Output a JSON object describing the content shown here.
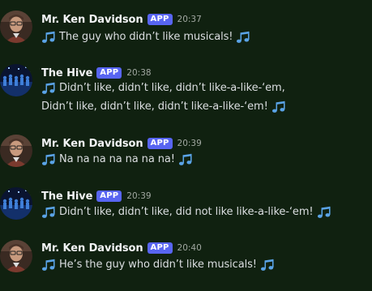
{
  "colors": {
    "background": "#102110",
    "author": "#f2f3f5",
    "badge_bg": "#5865f2",
    "timestamp": "#a1a8a1",
    "text": "#dbdee1",
    "note_icon": "#5aa3e6"
  },
  "icons": {
    "message_emoji": "notes-icon"
  },
  "messages": [
    {
      "author": "Mr. Ken Davidson",
      "badge": "APP",
      "time": "20:37",
      "lines": [
        "The guy who didn’t like musicals!"
      ]
    },
    {
      "author": "The Hive",
      "badge": "APP",
      "time": "20:38",
      "lines": [
        "Didn’t like, didn’t like, didn’t like-a-like-‘em,",
        "Didn’t like, didn’t like, didn’t like-a-like-‘em!"
      ]
    },
    {
      "author": "Mr. Ken Davidson",
      "badge": "APP",
      "time": "20:39",
      "lines": [
        "Na na na na na na na!"
      ]
    },
    {
      "author": "The Hive",
      "badge": "APP",
      "time": "20:39",
      "lines": [
        "Didn’t like, didn’t like, did not like like-a-like-‘em!"
      ]
    },
    {
      "author": "Mr. Ken Davidson",
      "badge": "APP",
      "time": "20:40",
      "lines": [
        "He’s the guy who didn’t like musicals!"
      ]
    }
  ]
}
